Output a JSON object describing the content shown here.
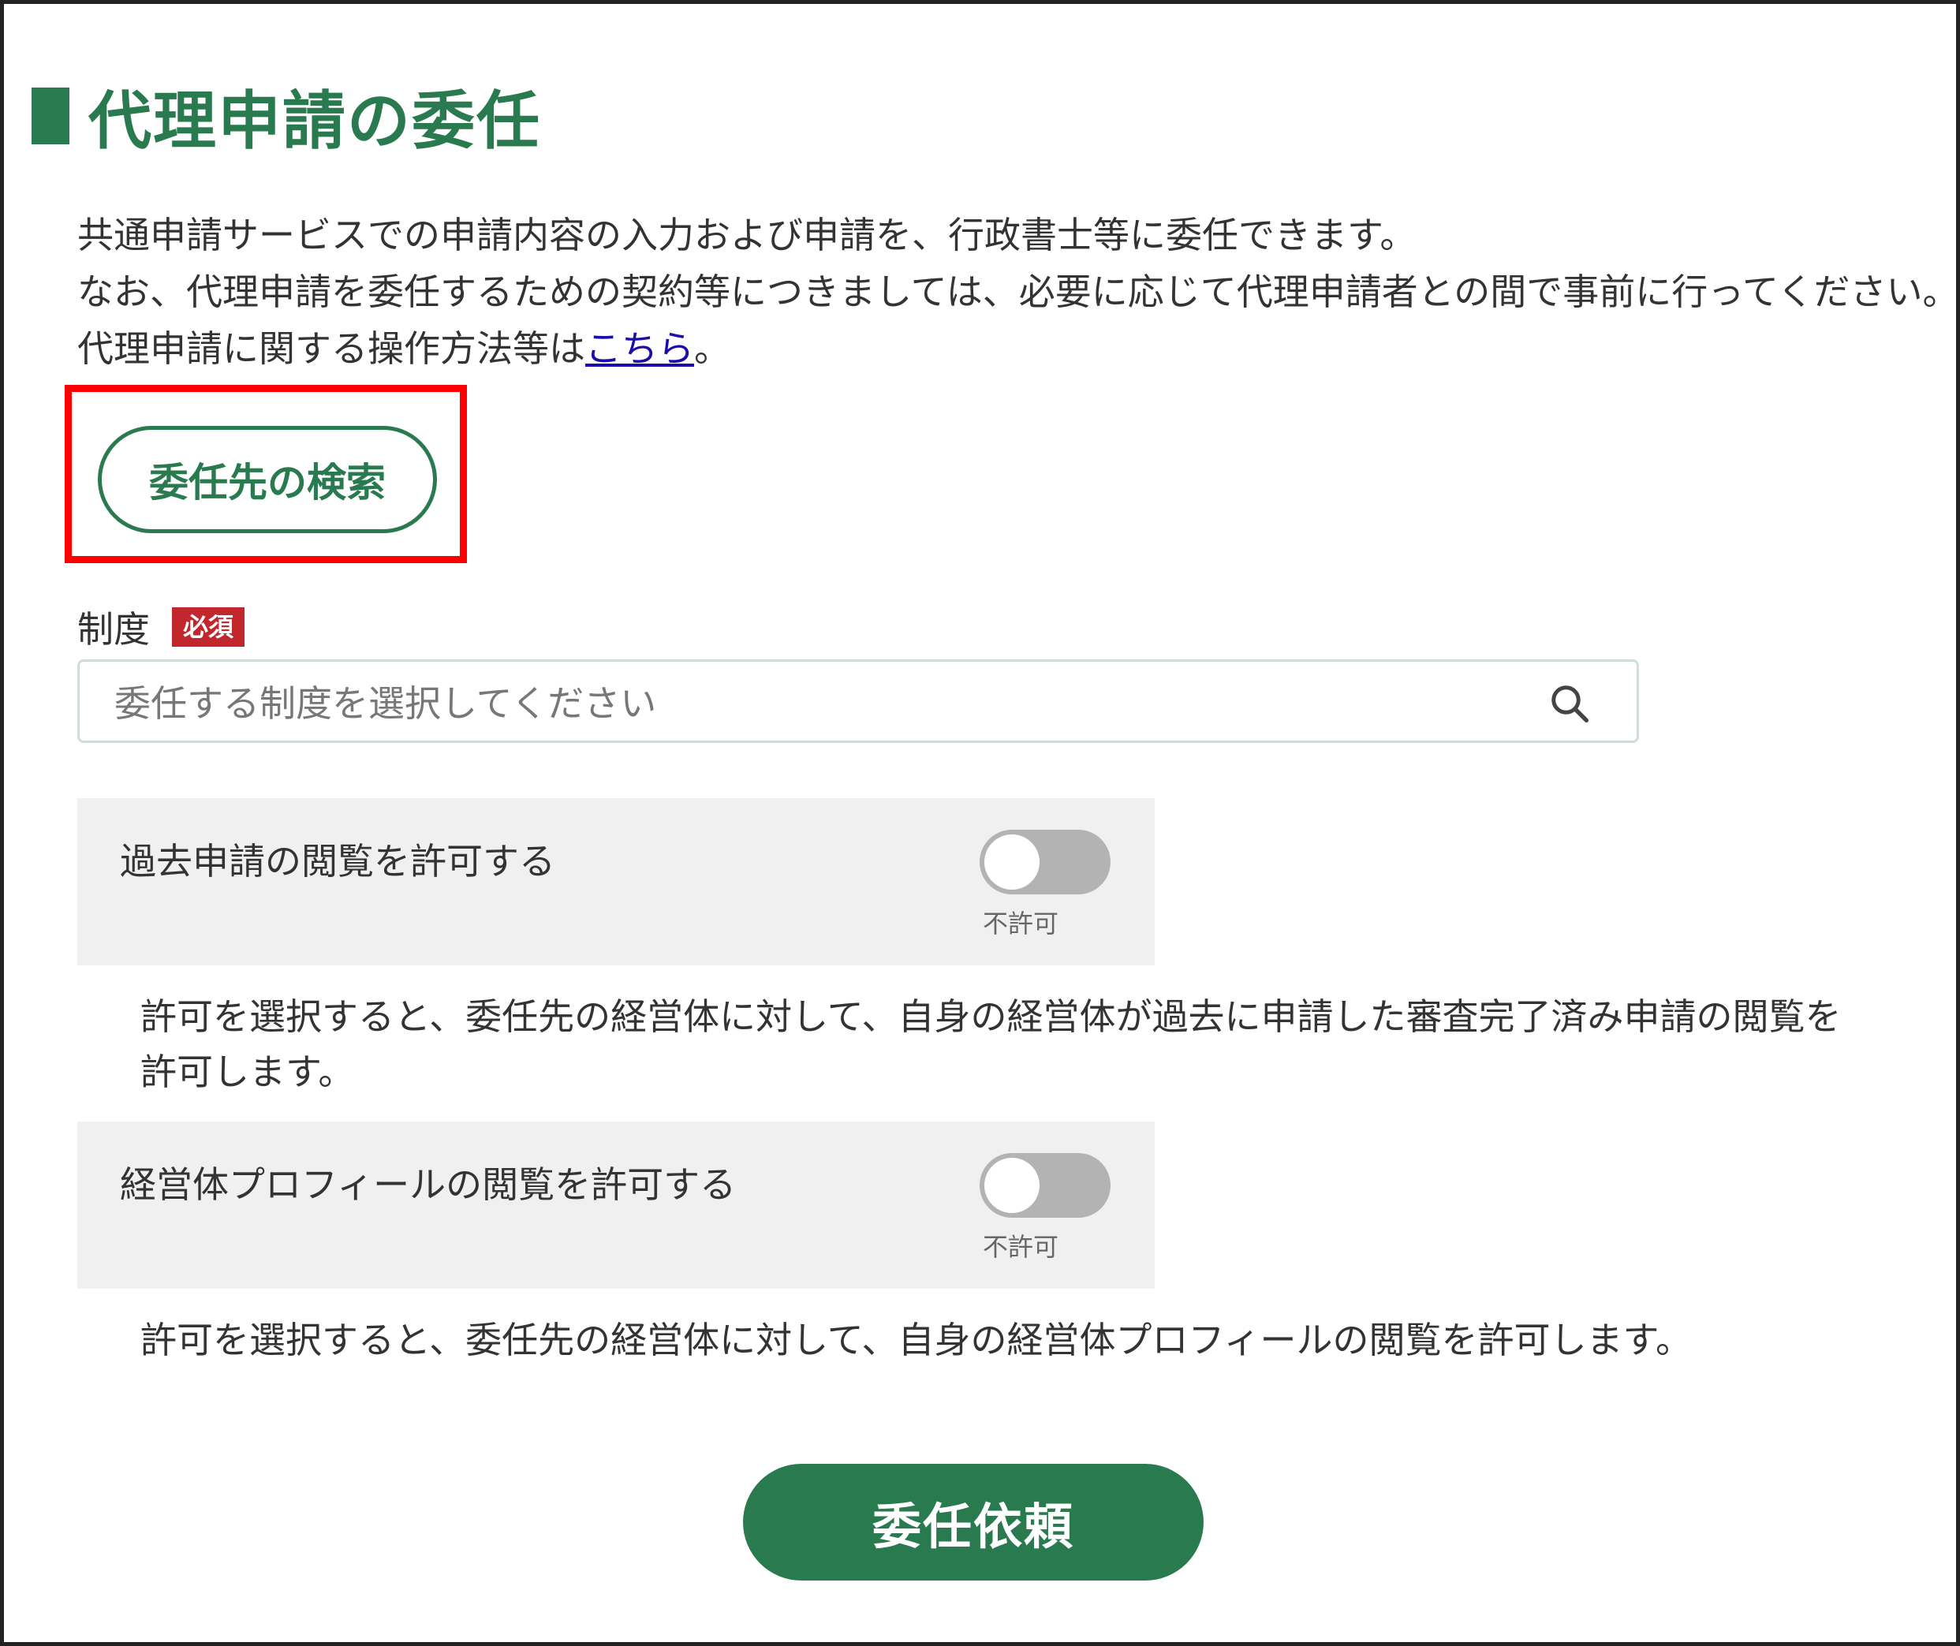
{
  "page": {
    "title": "代理申請の委任"
  },
  "intro": {
    "line1": "共通申請サービスでの申請内容の入力および申請を、行政書士等に委任できます。",
    "line2": "なお、代理申請を委任するための契約等につきましては、必要に応じて代理申請者との間で事前に行ってください。",
    "line3_prefix": "代理申請に関する操作方法等は",
    "line3_link": "こちら",
    "line3_suffix": "。"
  },
  "search_delegate_button": {
    "label": "委任先の検索"
  },
  "system_field": {
    "label": "制度",
    "required_badge": "必須",
    "placeholder": "委任する制度を選択してください",
    "icon": "search-icon"
  },
  "permissions": [
    {
      "label": "過去申請の閲覧を許可する",
      "toggle_on": false,
      "status": "不許可",
      "description": "許可を選択すると、委任先の経営体に対して、自身の経営体が過去に申請した審査完了済み申請の閲覧を許可します。"
    },
    {
      "label": "経営体プロフィールの閲覧を許可する",
      "toggle_on": false,
      "status": "不許可",
      "description": "許可を選択すると、委任先の経営体に対して、自身の経営体プロフィールの閲覧を許可します。"
    }
  ],
  "submit_button": {
    "label": "委任依頼"
  },
  "colors": {
    "brand_green": "#2a7a4f",
    "required_red": "#c1272d",
    "highlight_red": "#ff0000",
    "link_blue": "#1a0dab",
    "toggle_off": "#b3b3b3",
    "panel_bg": "#f0f0f0"
  }
}
